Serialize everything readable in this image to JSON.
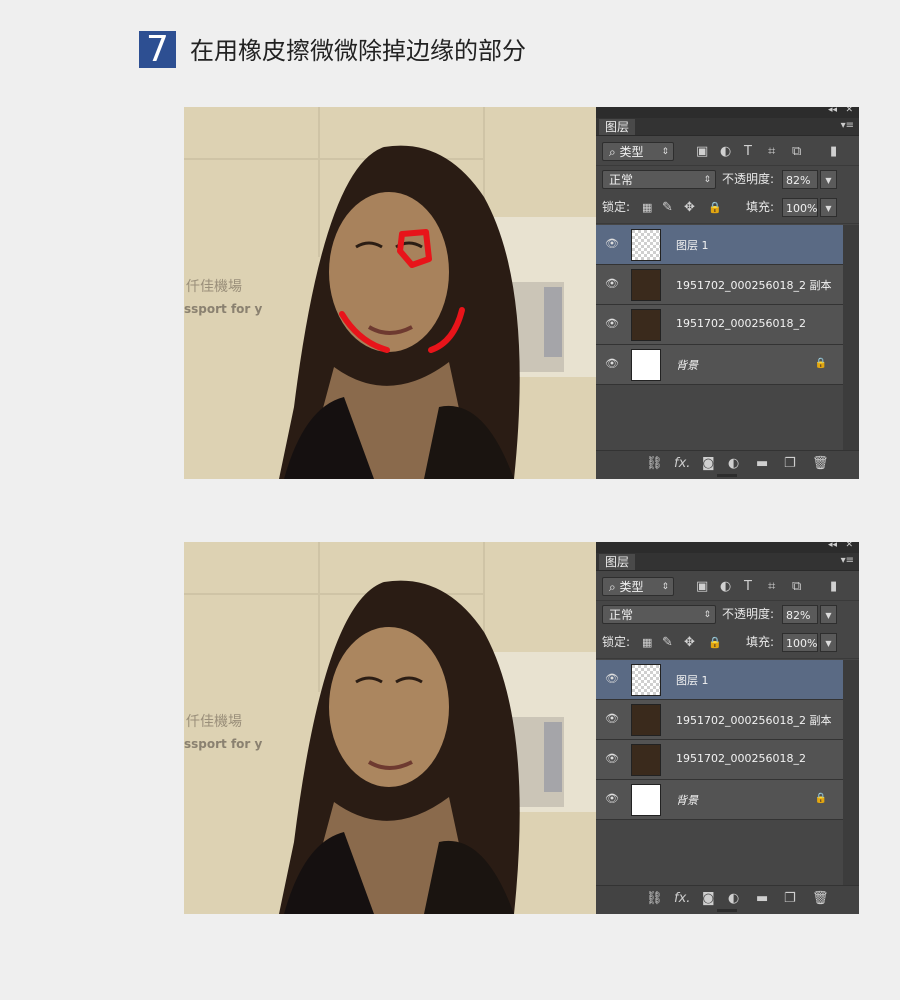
{
  "step": {
    "number": "7",
    "title": "在用橡皮擦微微除掉边缘的部分"
  },
  "panel": {
    "tab_label": "图层",
    "filter_type_label": "类型",
    "blend_mode": "正常",
    "opacity_label": "不透明度:",
    "opacity_value": "82%",
    "lock_label": "锁定:",
    "fill_label": "填充:",
    "fill_value": "100%",
    "layers": [
      {
        "name": "图层 1",
        "selected": true,
        "thumb": "checker"
      },
      {
        "name": "1951702_000256018_2 副本",
        "selected": false,
        "thumb": "face"
      },
      {
        "name": "1951702_000256018_2",
        "selected": false,
        "thumb": "face"
      },
      {
        "name": "背景",
        "selected": false,
        "thumb": "white",
        "locked": true
      }
    ]
  },
  "sign_text": {
    "line1": "仟佳機場",
    "line2": "ssport for y"
  },
  "icons": [
    "eye-icon",
    "lock-icon",
    "search-icon",
    "link-icon",
    "fx-icon",
    "mask-icon",
    "adjustment-icon",
    "folder-icon",
    "new-layer-icon",
    "trash-icon"
  ]
}
